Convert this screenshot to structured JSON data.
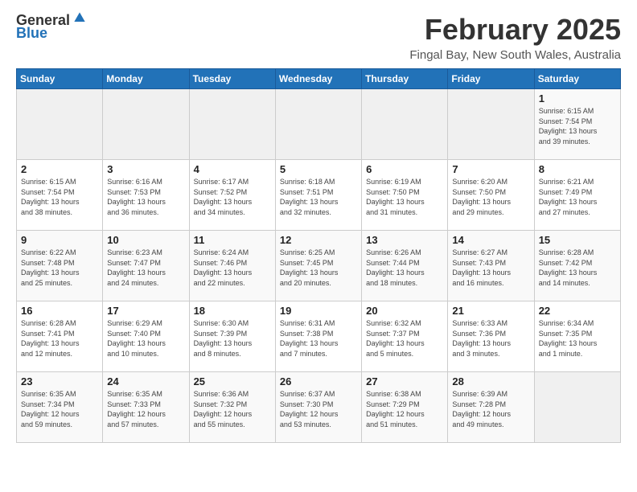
{
  "logo": {
    "general": "General",
    "blue": "Blue"
  },
  "header": {
    "month": "February 2025",
    "location": "Fingal Bay, New South Wales, Australia"
  },
  "days_of_week": [
    "Sunday",
    "Monday",
    "Tuesday",
    "Wednesday",
    "Thursday",
    "Friday",
    "Saturday"
  ],
  "weeks": [
    [
      {
        "day": "",
        "info": ""
      },
      {
        "day": "",
        "info": ""
      },
      {
        "day": "",
        "info": ""
      },
      {
        "day": "",
        "info": ""
      },
      {
        "day": "",
        "info": ""
      },
      {
        "day": "",
        "info": ""
      },
      {
        "day": "1",
        "info": "Sunrise: 6:15 AM\nSunset: 7:54 PM\nDaylight: 13 hours\nand 39 minutes."
      }
    ],
    [
      {
        "day": "2",
        "info": "Sunrise: 6:15 AM\nSunset: 7:54 PM\nDaylight: 13 hours\nand 38 minutes."
      },
      {
        "day": "3",
        "info": "Sunrise: 6:16 AM\nSunset: 7:53 PM\nDaylight: 13 hours\nand 36 minutes."
      },
      {
        "day": "4",
        "info": "Sunrise: 6:17 AM\nSunset: 7:52 PM\nDaylight: 13 hours\nand 34 minutes."
      },
      {
        "day": "5",
        "info": "Sunrise: 6:18 AM\nSunset: 7:51 PM\nDaylight: 13 hours\nand 32 minutes."
      },
      {
        "day": "6",
        "info": "Sunrise: 6:19 AM\nSunset: 7:50 PM\nDaylight: 13 hours\nand 31 minutes."
      },
      {
        "day": "7",
        "info": "Sunrise: 6:20 AM\nSunset: 7:50 PM\nDaylight: 13 hours\nand 29 minutes."
      },
      {
        "day": "8",
        "info": "Sunrise: 6:21 AM\nSunset: 7:49 PM\nDaylight: 13 hours\nand 27 minutes."
      }
    ],
    [
      {
        "day": "9",
        "info": "Sunrise: 6:22 AM\nSunset: 7:48 PM\nDaylight: 13 hours\nand 25 minutes."
      },
      {
        "day": "10",
        "info": "Sunrise: 6:23 AM\nSunset: 7:47 PM\nDaylight: 13 hours\nand 24 minutes."
      },
      {
        "day": "11",
        "info": "Sunrise: 6:24 AM\nSunset: 7:46 PM\nDaylight: 13 hours\nand 22 minutes."
      },
      {
        "day": "12",
        "info": "Sunrise: 6:25 AM\nSunset: 7:45 PM\nDaylight: 13 hours\nand 20 minutes."
      },
      {
        "day": "13",
        "info": "Sunrise: 6:26 AM\nSunset: 7:44 PM\nDaylight: 13 hours\nand 18 minutes."
      },
      {
        "day": "14",
        "info": "Sunrise: 6:27 AM\nSunset: 7:43 PM\nDaylight: 13 hours\nand 16 minutes."
      },
      {
        "day": "15",
        "info": "Sunrise: 6:28 AM\nSunset: 7:42 PM\nDaylight: 13 hours\nand 14 minutes."
      }
    ],
    [
      {
        "day": "16",
        "info": "Sunrise: 6:28 AM\nSunset: 7:41 PM\nDaylight: 13 hours\nand 12 minutes."
      },
      {
        "day": "17",
        "info": "Sunrise: 6:29 AM\nSunset: 7:40 PM\nDaylight: 13 hours\nand 10 minutes."
      },
      {
        "day": "18",
        "info": "Sunrise: 6:30 AM\nSunset: 7:39 PM\nDaylight: 13 hours\nand 8 minutes."
      },
      {
        "day": "19",
        "info": "Sunrise: 6:31 AM\nSunset: 7:38 PM\nDaylight: 13 hours\nand 7 minutes."
      },
      {
        "day": "20",
        "info": "Sunrise: 6:32 AM\nSunset: 7:37 PM\nDaylight: 13 hours\nand 5 minutes."
      },
      {
        "day": "21",
        "info": "Sunrise: 6:33 AM\nSunset: 7:36 PM\nDaylight: 13 hours\nand 3 minutes."
      },
      {
        "day": "22",
        "info": "Sunrise: 6:34 AM\nSunset: 7:35 PM\nDaylight: 13 hours\nand 1 minute."
      }
    ],
    [
      {
        "day": "23",
        "info": "Sunrise: 6:35 AM\nSunset: 7:34 PM\nDaylight: 12 hours\nand 59 minutes."
      },
      {
        "day": "24",
        "info": "Sunrise: 6:35 AM\nSunset: 7:33 PM\nDaylight: 12 hours\nand 57 minutes."
      },
      {
        "day": "25",
        "info": "Sunrise: 6:36 AM\nSunset: 7:32 PM\nDaylight: 12 hours\nand 55 minutes."
      },
      {
        "day": "26",
        "info": "Sunrise: 6:37 AM\nSunset: 7:30 PM\nDaylight: 12 hours\nand 53 minutes."
      },
      {
        "day": "27",
        "info": "Sunrise: 6:38 AM\nSunset: 7:29 PM\nDaylight: 12 hours\nand 51 minutes."
      },
      {
        "day": "28",
        "info": "Sunrise: 6:39 AM\nSunset: 7:28 PM\nDaylight: 12 hours\nand 49 minutes."
      },
      {
        "day": "",
        "info": ""
      }
    ]
  ]
}
